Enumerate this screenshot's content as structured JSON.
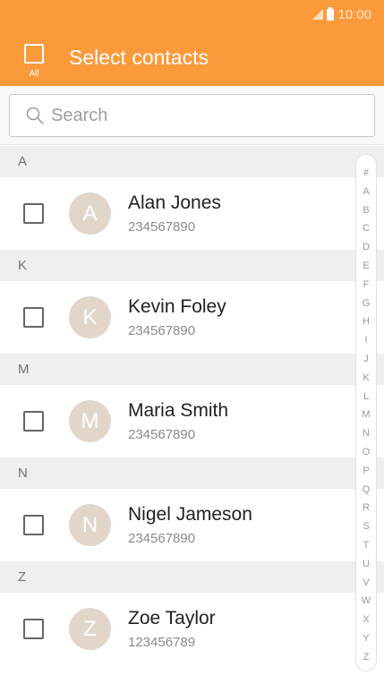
{
  "status_bar": {
    "time": "10:00",
    "icons": [
      "signal-icon",
      "battery-icon"
    ]
  },
  "header": {
    "select_all_label": "All",
    "title": "Select contacts",
    "color": "#fb9a3b"
  },
  "search": {
    "placeholder": "Search",
    "value": ""
  },
  "sections": [
    {
      "letter": "A",
      "contacts": [
        {
          "initial": "A",
          "name": "Alan Jones",
          "phone": "234567890",
          "checked": false
        }
      ]
    },
    {
      "letter": "K",
      "contacts": [
        {
          "initial": "K",
          "name": "Kevin Foley",
          "phone": "234567890",
          "checked": false
        }
      ]
    },
    {
      "letter": "M",
      "contacts": [
        {
          "initial": "M",
          "name": "Maria Smith",
          "phone": "234567890",
          "checked": false
        }
      ]
    },
    {
      "letter": "N",
      "contacts": [
        {
          "initial": "N",
          "name": "Nigel Jameson",
          "phone": "234567890",
          "checked": false
        }
      ]
    },
    {
      "letter": "Z",
      "contacts": [
        {
          "initial": "Z",
          "name": "Zoe Taylor",
          "phone": "123456789",
          "checked": false
        }
      ]
    }
  ],
  "index_letters": [
    "#",
    "A",
    "B",
    "C",
    "D",
    "E",
    "F",
    "G",
    "H",
    "I",
    "J",
    "K",
    "L",
    "M",
    "N",
    "O",
    "P",
    "Q",
    "R",
    "S",
    "T",
    "U",
    "V",
    "W",
    "X",
    "Y",
    "Z"
  ]
}
